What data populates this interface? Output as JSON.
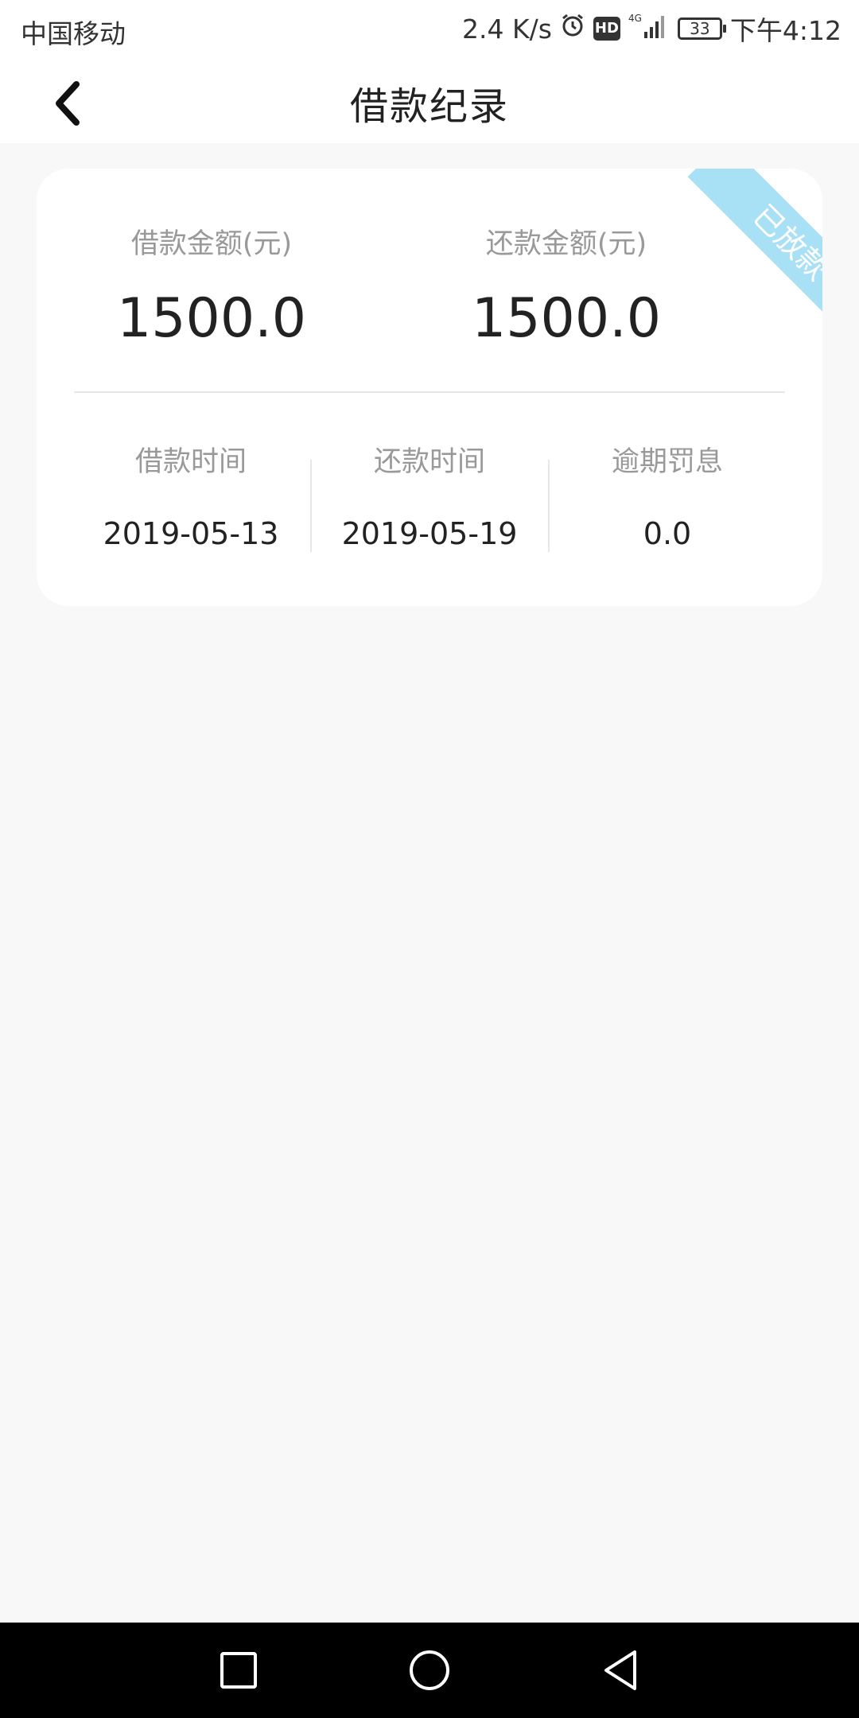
{
  "status_bar": {
    "carrier": "中国移动",
    "net_speed": "2.4 K/s",
    "hd": "HD",
    "network_type": "4G",
    "battery": "33",
    "time": "下午4:12"
  },
  "header": {
    "title": "借款纪录",
    "back_icon": "chevron-left-icon"
  },
  "loan_card": {
    "status_ribbon": "已放款",
    "status_color": "#a8e0f5",
    "loan_amount_label": "借款金额(元)",
    "loan_amount_value": "1500.0",
    "repay_amount_label": "还款金额(元)",
    "repay_amount_value": "1500.0",
    "details": [
      {
        "label": "借款时间",
        "value": "2019-05-13"
      },
      {
        "label": "还款时间",
        "value": "2019-05-19"
      },
      {
        "label": "逾期罚息",
        "value": "0.0"
      }
    ]
  },
  "system_nav": {
    "recent_icon": "square-icon",
    "home_icon": "circle-icon",
    "back_icon": "triangle-back-icon"
  }
}
